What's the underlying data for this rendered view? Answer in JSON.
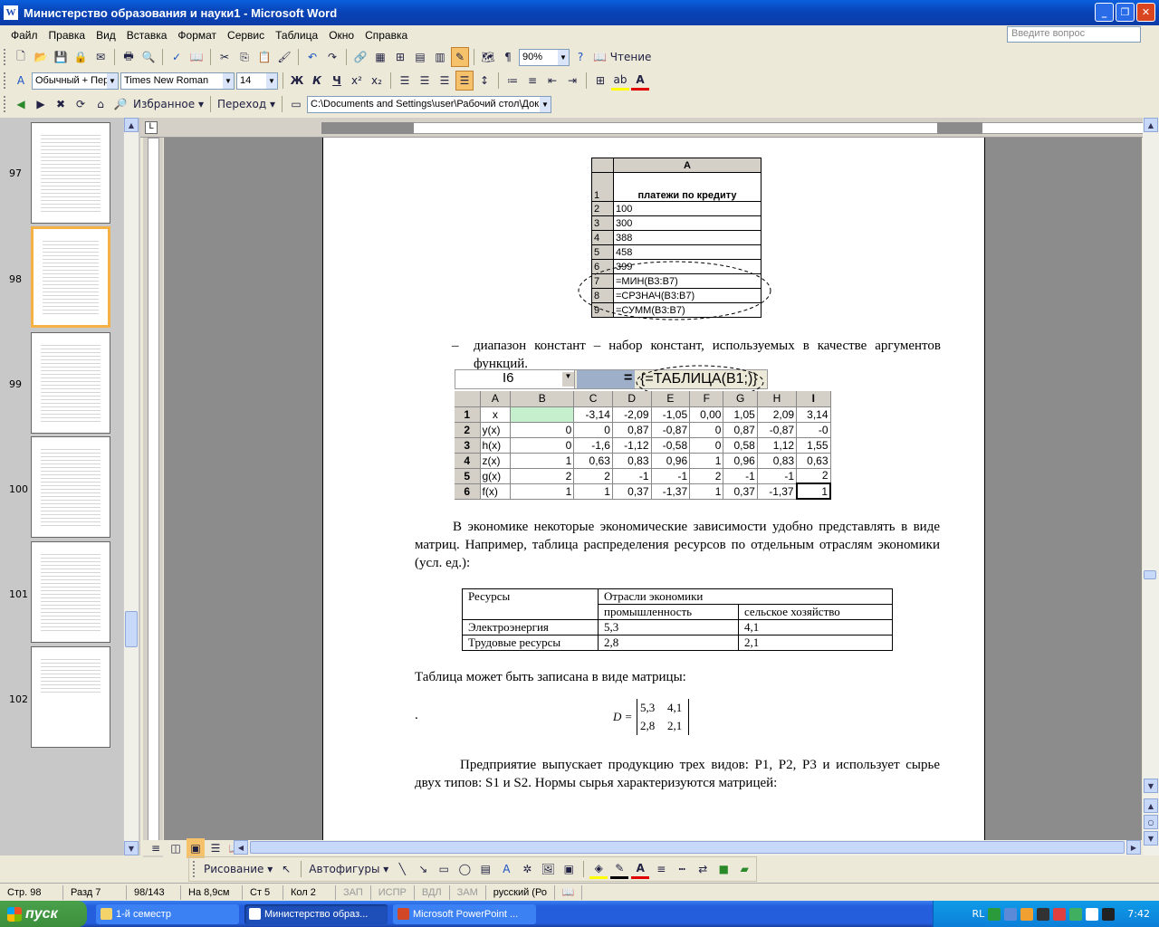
{
  "window": {
    "title": "Министерство образования и науки1 - Microsoft Word",
    "app_letter": "W",
    "min": "_",
    "max": "❐",
    "close": "✕"
  },
  "menu": {
    "items": [
      "Файл",
      "Правка",
      "Вид",
      "Вставка",
      "Формат",
      "Сервис",
      "Таблица",
      "Окно",
      "Справка"
    ],
    "ask_placeholder": "Введите вопрос"
  },
  "toolbar1": {
    "zoom": "90%",
    "reading": "Чтение"
  },
  "toolbar2": {
    "style": "Обычный + Пер",
    "font": "Times New Roman",
    "size": "14",
    "bold": "Ж",
    "italic": "К",
    "underline": "Ч"
  },
  "toolbar3": {
    "favorites": "Избранное",
    "go": "Переход",
    "address": "C:\\Documents and Settings\\user\\Рабочий стол\\Док"
  },
  "thumbnails": {
    "pages": [
      "97",
      "98",
      "99",
      "100",
      "101",
      "102"
    ],
    "selected": "98"
  },
  "doc": {
    "table1": {
      "col": "A",
      "rows": [
        [
          "1",
          "платежи по кредиту"
        ],
        [
          "2",
          "100"
        ],
        [
          "3",
          "300"
        ],
        [
          "4",
          "388"
        ],
        [
          "5",
          "458"
        ],
        [
          "6",
          "399"
        ],
        [
          "7",
          "=МИН(B3:B7)"
        ],
        [
          "8",
          "=СРЗНАЧ(B3:B7)"
        ],
        [
          "9",
          "=СУММ(B3:B7)"
        ]
      ]
    },
    "bullet": "–",
    "bullet_text": "диапазон констант – набор констант, используемых в качестве аргументов функций.",
    "formula_cell": "I6",
    "formula_eq": "=",
    "formula_text": "{=ТАБЛИЦА(B1;)}",
    "sheet": {
      "headers": [
        "",
        "A",
        "B",
        "C",
        "D",
        "E",
        "F",
        "G",
        "H",
        "I"
      ],
      "rows": [
        [
          "1",
          "x",
          "",
          "-3,14",
          "-2,09",
          "-1,05",
          "0,00",
          "1,05",
          "2,09",
          "3,14"
        ],
        [
          "2",
          "y(x)",
          "0",
          "0",
          "0,87",
          "-0,87",
          "0",
          "0,87",
          "-0,87",
          "-0"
        ],
        [
          "3",
          "h(x)",
          "0",
          "-1,6",
          "-1,12",
          "-0,58",
          "0",
          "0,58",
          "1,12",
          "1,55"
        ],
        [
          "4",
          "z(x)",
          "1",
          "0,63",
          "0,83",
          "0,96",
          "1",
          "0,96",
          "0,83",
          "0,63"
        ],
        [
          "5",
          "g(x)",
          "2",
          "2",
          "-1",
          "-1",
          "2",
          "-1",
          "-1",
          "2"
        ],
        [
          "6",
          "f(x)",
          "1",
          "1",
          "0,37",
          "-1,37",
          "1",
          "0,37",
          "-1,37",
          "1"
        ]
      ]
    },
    "para1": "В экономике некоторые экономические зависимости удобно представлять в виде матриц. Например, таблица распределения ресурсов по отдельным отраслям экономики (усл. ед.):",
    "res_table": {
      "h1": "Ресурсы",
      "h2": "Отрасли экономики",
      "h3": "промышленность",
      "h4": "сельское хозяйство",
      "r1": [
        "Электроэнергия",
        "5,3",
        "4,1"
      ],
      "r2": [
        "Трудовые ресурсы",
        "2,8",
        "2,1"
      ]
    },
    "para2": "Таблица может быть записана в виде матрицы:",
    "dot": ".",
    "matrix": {
      "label": "D =",
      "a": "5,3",
      "b": "4,1",
      "c": "2,8",
      "d": "2,1"
    },
    "para3": "Предприятие выпускает продукцию трех видов: P1, P2, P3 и использует сырье двух типов: S1 и S2. Нормы сырья характеризуются матрицей:"
  },
  "drawbar": {
    "draw": "Рисование",
    "autoshapes": "Автофигуры"
  },
  "status": {
    "page": "Стр. 98",
    "section": "Разд 7",
    "pages": "98/143",
    "at": "На 8,9см",
    "line": "Ст 5",
    "col": "Кол 2",
    "rec": "ЗАП",
    "trk": "ИСПР",
    "ext": "ВДЛ",
    "ovr": "ЗАМ",
    "lang": "русский (Ро"
  },
  "taskbar": {
    "start": "пуск",
    "tasks": [
      "1-й семестр",
      "Министерство образ...",
      "Microsoft PowerPoint ..."
    ],
    "lang": "RL",
    "time": "7:42"
  },
  "colors": {
    "titlebar": "#0A3CA8",
    "taskbar": "#245EDC",
    "start": "#3C8E3C",
    "highlight": "#C6EFCE"
  }
}
